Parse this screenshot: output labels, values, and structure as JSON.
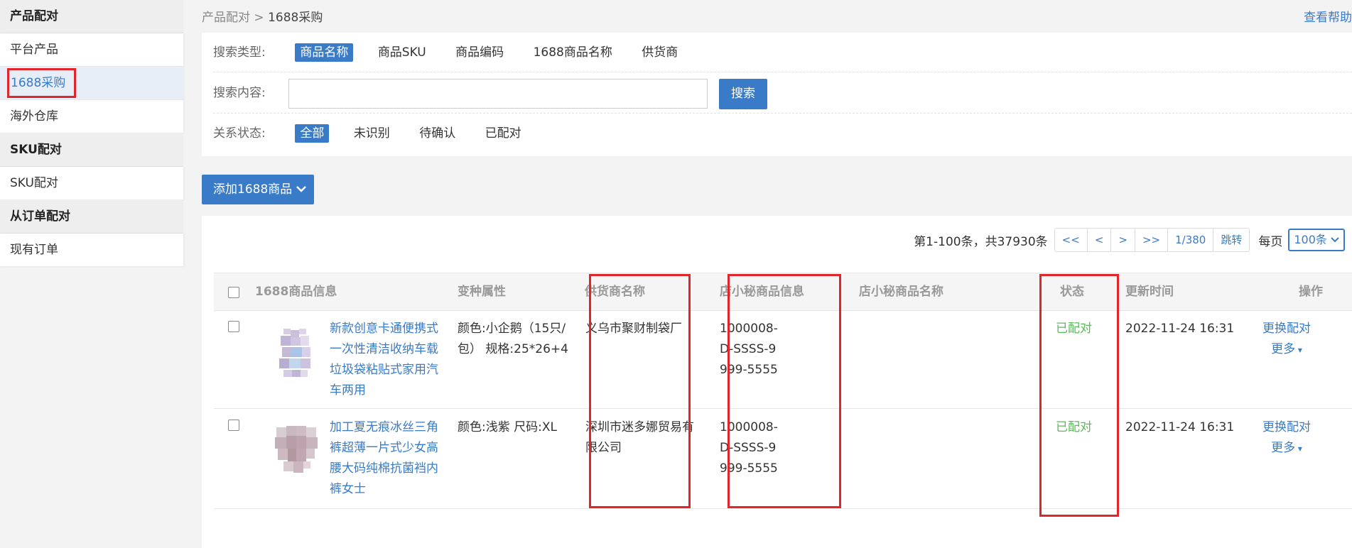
{
  "sidebar": {
    "sections": [
      {
        "title": "产品配对",
        "items": [
          "平台产品",
          "1688采购",
          "海外仓库"
        ]
      },
      {
        "title": "SKU配对",
        "items": [
          "SKU配对"
        ]
      },
      {
        "title": "从订单配对",
        "items": [
          "现有订单"
        ]
      }
    ],
    "active_item": "1688采购"
  },
  "breadcrumb": {
    "parent": "产品配对",
    "sep": ">",
    "current": "1688采购"
  },
  "help_link": "查看帮助",
  "search": {
    "type_label": "搜索类型:",
    "type_options": [
      "商品名称",
      "商品SKU",
      "商品编码",
      "1688商品名称",
      "供货商"
    ],
    "content_label": "搜索内容:",
    "input_value": "",
    "button": "搜索",
    "status_label": "关系状态:",
    "status_options": [
      "全部",
      "未识别",
      "待确认",
      "已配对"
    ]
  },
  "add_button": "添加1688商品",
  "pager": {
    "info": "第1-100条，共37930条",
    "first": "<<",
    "prev": "<",
    "next": ">",
    "last": ">>",
    "page": "1/380",
    "jump": "跳转",
    "per_page_label": "每页",
    "per_page_value": "100条"
  },
  "table": {
    "headers": [
      "1688商品信息",
      "变种属性",
      "供货商名称",
      "店小秘商品信息",
      "店小秘商品名称",
      "状态",
      "更新时间",
      "操作"
    ],
    "rows": [
      {
        "title_lines": [
          "新款创意卡通便携式",
          "一次性清洁收纳车载",
          "垃圾袋粘贴式家用汽",
          "车两用"
        ],
        "attr_lines": [
          "颜色:小企鹅（15只/",
          "包） 规格:25*26+4"
        ],
        "supplier_lines": [
          "义乌市聚财制袋厂"
        ],
        "sku_lines": [
          "1000008-",
          "D-SSSS-9",
          "999-5555"
        ],
        "dxm_name": "",
        "status": "已配对",
        "updated": "2022-11-24 16:31",
        "action1": "更换配对",
        "action2": "更多"
      },
      {
        "title_lines": [
          "加工夏无痕冰丝三角",
          "裤超薄一片式少女高",
          "腰大码纯棉抗菌裆内",
          "裤女士"
        ],
        "attr_lines": [
          "颜色:浅紫 尺码:XL"
        ],
        "supplier_lines": [
          "深圳市迷多娜贸易有",
          "限公司"
        ],
        "sku_lines": [
          "1000008-",
          "D-SSSS-9",
          "999-5555"
        ],
        "dxm_name": "",
        "status": "已配对",
        "updated": "2022-11-24 16:31",
        "action1": "更换配对",
        "action2": "更多"
      }
    ]
  }
}
